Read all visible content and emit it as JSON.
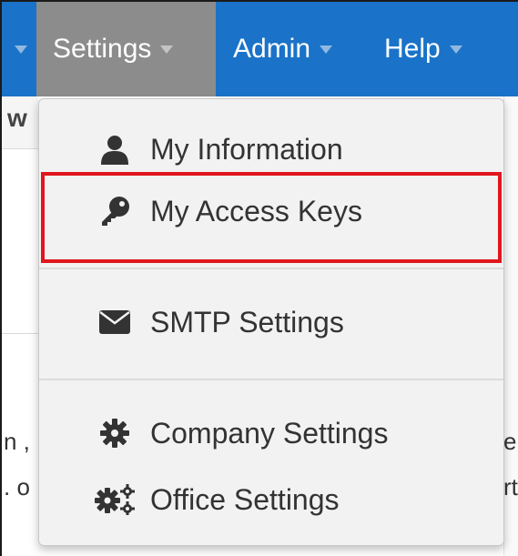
{
  "navbar": {
    "items": [
      {
        "label": "Settings"
      },
      {
        "label": "Admin"
      },
      {
        "label": "Help"
      }
    ],
    "colors": {
      "background": "#1a73c8",
      "active": "#8c8c8c"
    }
  },
  "background": {
    "header_fragment": "w",
    "text_fragments": [
      "n ,",
      ". o",
      "e",
      "rt"
    ]
  },
  "dropdown": {
    "items": [
      {
        "label": "My Information",
        "icon": "user-icon"
      },
      {
        "label": "My Access Keys",
        "icon": "key-icon"
      },
      {
        "label": "SMTP Settings",
        "icon": "envelope-icon"
      },
      {
        "label": "Company Settings",
        "icon": "gear-icon"
      },
      {
        "label": "Office Settings",
        "icon": "gears-icon"
      }
    ],
    "highlight_color": "#e0171d"
  }
}
